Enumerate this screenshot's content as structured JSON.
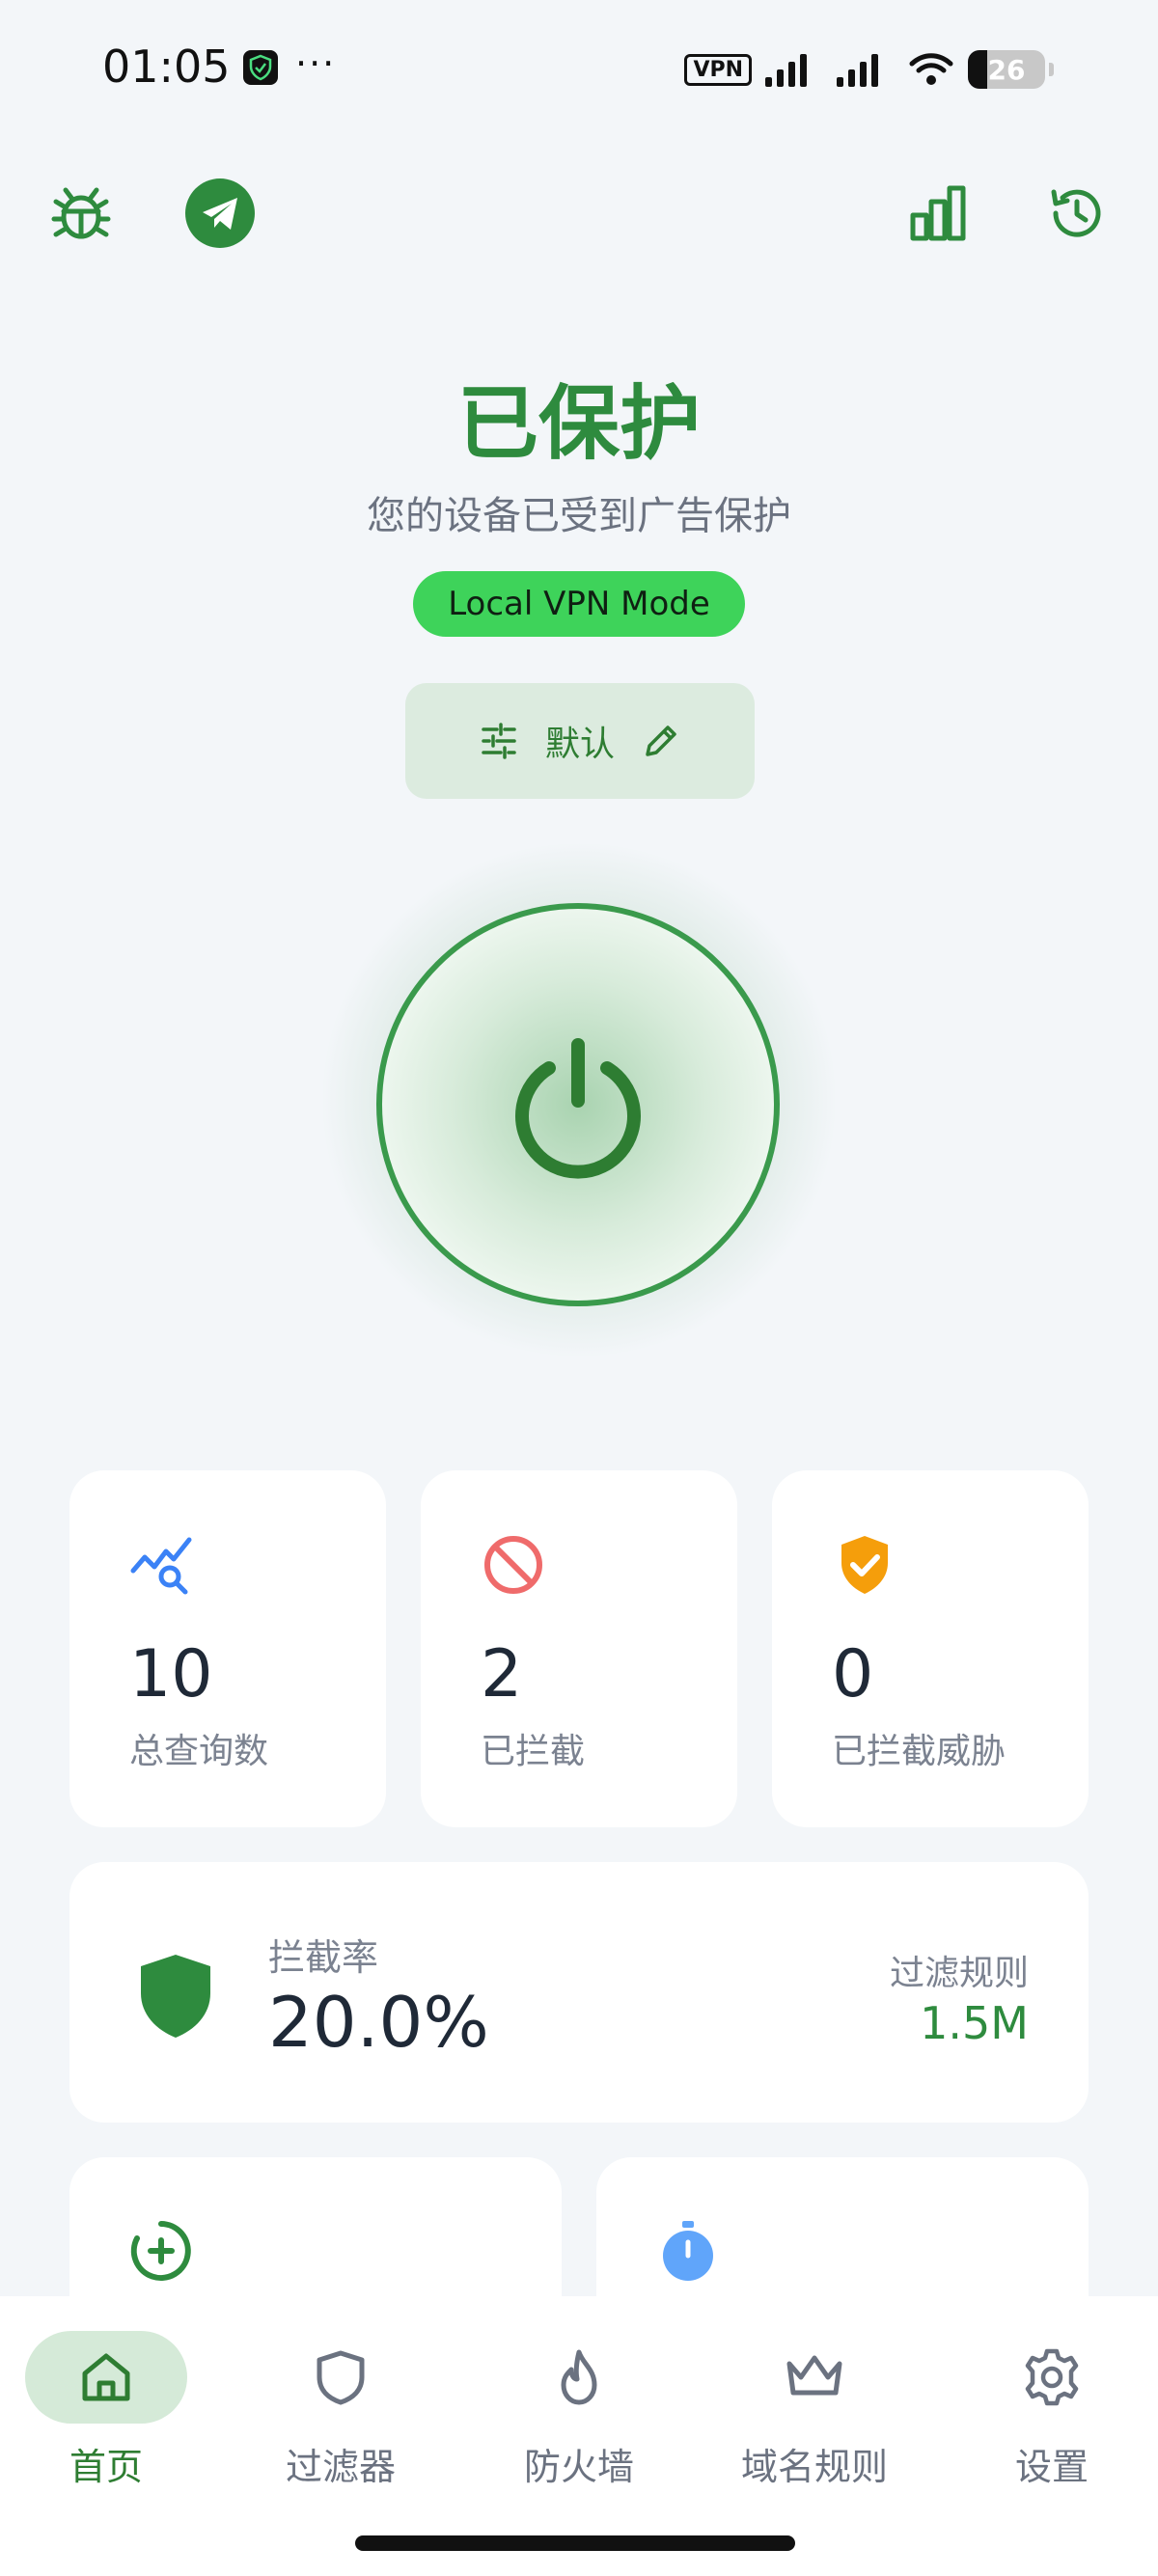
{
  "status_bar": {
    "time": "01:05",
    "more": "···",
    "vpn_badge": "VPN",
    "battery": "26"
  },
  "header": {
    "left_icons": [
      "bug-icon",
      "telegram-icon"
    ],
    "right_icons": [
      "bar-chart-icon",
      "history-icon"
    ]
  },
  "hero": {
    "title": "已保护",
    "subtitle": "您的设备已受到广告保护",
    "mode": "Local VPN Mode",
    "profile": "默认"
  },
  "stats": [
    {
      "icon": "query-search-icon",
      "value": "10",
      "label": "总查询数",
      "color": "#3b82f6"
    },
    {
      "icon": "block-icon",
      "value": "2",
      "label": "已拦截",
      "color": "#ef6b6b"
    },
    {
      "icon": "shield-check-icon",
      "value": "0",
      "label": "已拦截威胁",
      "color": "#f59e0b"
    }
  ],
  "rate": {
    "label": "拦截率",
    "value": "20.0%",
    "rules_label": "过滤规则",
    "rules_value": "1.5M"
  },
  "nav": {
    "items": [
      {
        "label": "首页",
        "icon": "home-icon",
        "active": true
      },
      {
        "label": "过滤器",
        "icon": "shield-outline-icon",
        "active": false
      },
      {
        "label": "防火墙",
        "icon": "flame-icon",
        "active": false
      },
      {
        "label": "域名规则",
        "icon": "crown-icon",
        "active": false
      },
      {
        "label": "设置",
        "icon": "gear-icon",
        "active": false
      }
    ]
  },
  "colors": {
    "primary": "#2e8b3e",
    "mode_pill": "#3ed35a",
    "background": "#f3f6f9"
  }
}
